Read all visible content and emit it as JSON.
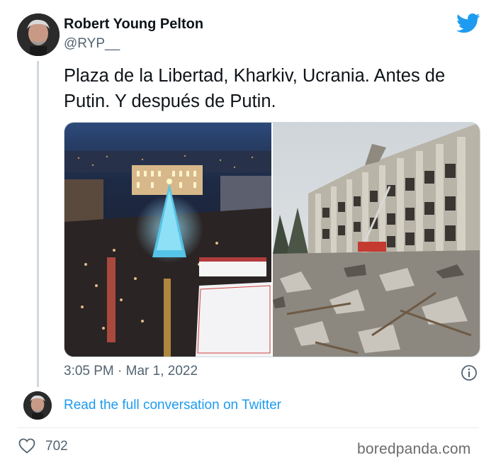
{
  "tweet": {
    "author_name": "Robert Young Pelton",
    "author_handle": "@RYP__",
    "text": "Plaza de la Libertad, Kharkiv, Ucrania. Antes de Putin. Y después de Putin.",
    "timestamp": "3:05 PM · Mar 1, 2022",
    "read_more_link": "Read the full conversation on Twitter",
    "like_count": "702"
  },
  "media": {
    "left_image": "night-square-christmas-tree-photo",
    "right_image": "destroyed-building-rubble-photo"
  },
  "watermark": "boredpanda.com",
  "icons": {
    "brand": "twitter-bird-icon",
    "info": "info-icon",
    "like": "heart-icon"
  },
  "colors": {
    "twitter_blue": "#1d9bf0",
    "secondary_text": "#536471",
    "primary_text": "#0f1419"
  }
}
